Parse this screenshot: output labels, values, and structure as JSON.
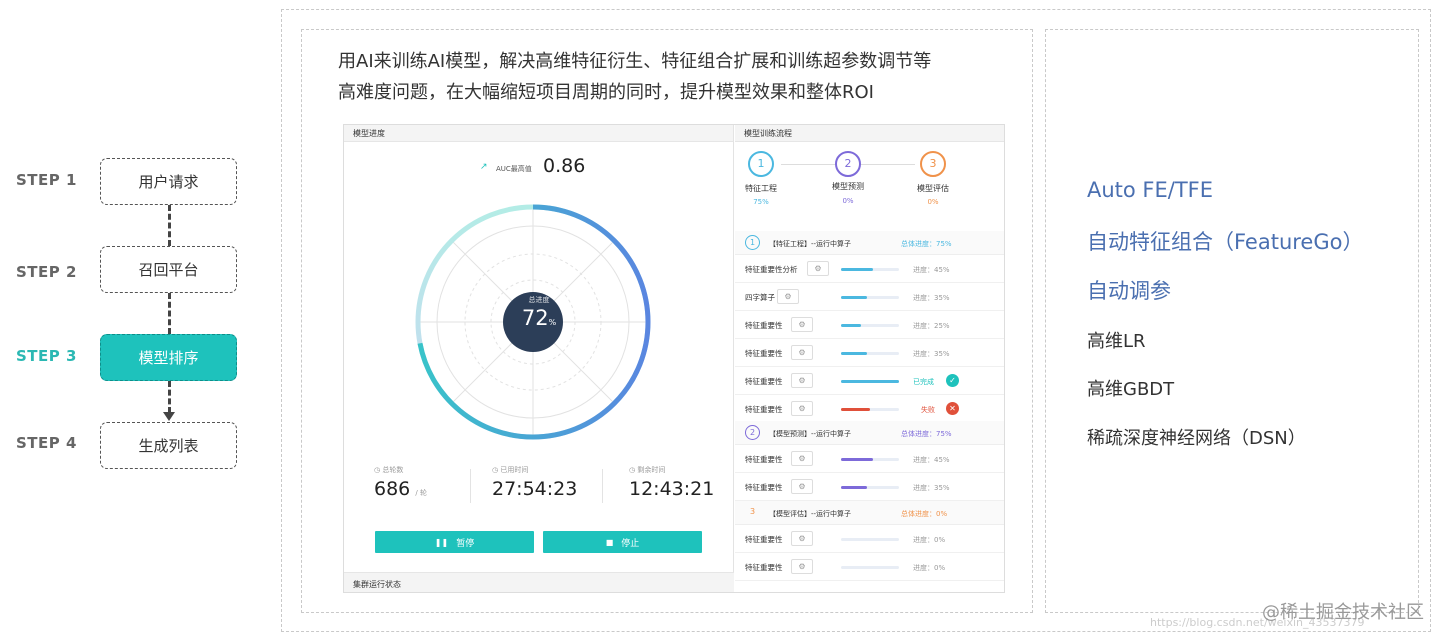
{
  "steps": [
    {
      "label": "STEP 1",
      "box": "用户请求"
    },
    {
      "label": "STEP 2",
      "box": "召回平台"
    },
    {
      "label": "STEP 3",
      "box": "模型排序"
    },
    {
      "label": "STEP 4",
      "box": "生成列表"
    }
  ],
  "intro": {
    "line1": "用AI来训练AI模型，解决高维特征衍生、特征组合扩展和训练超参数调节等",
    "line2": "高难度问题，在大幅缩短项目周期的同时，提升模型效果和整体ROI"
  },
  "left_panel": {
    "title": "模型进度",
    "auc_label": "AUC最高值",
    "auc_value": "0.86",
    "total_label": "总进度",
    "total_value": "72",
    "total_unit": "%",
    "total_fraction": 0.72,
    "stats": [
      {
        "label": "总轮数",
        "value": "686",
        "unit": "/ 轮"
      },
      {
        "label": "已用时间",
        "value": "27:54:23",
        "unit": ""
      },
      {
        "label": "剩余时间",
        "value": "12:43:21",
        "unit": ""
      }
    ],
    "pause_button": "暂停",
    "stop_button": "停止",
    "cluster_title": "集群运行状态"
  },
  "right_panel": {
    "title": "模型训练流程",
    "stages": [
      {
        "num": "1",
        "name": "特征工程",
        "pct": "75%",
        "color": "#4bb8e0"
      },
      {
        "num": "2",
        "name": "模型预测",
        "pct": "0%",
        "color": "#7d6ad9"
      },
      {
        "num": "3",
        "name": "模型评估",
        "pct": "0%",
        "color": "#f0924a"
      }
    ],
    "sections": [
      {
        "num": "1",
        "title": "【特征工程】--运行中算子",
        "progress": "总体进度：75%",
        "color": "#4bb8e0",
        "rows": [
          {
            "name": "特征重要性分析",
            "status": "进度：45%",
            "fill": 0.55,
            "color": "#4bb8e0"
          },
          {
            "name": "四字算子",
            "status": "进度：35%",
            "fill": 0.45,
            "color": "#4bb8e0"
          },
          {
            "name": "特征重要性",
            "status": "进度：25%",
            "fill": 0.35,
            "color": "#4bb8e0"
          },
          {
            "name": "特征重要性",
            "status": "进度：35%",
            "fill": 0.45,
            "color": "#4bb8e0"
          },
          {
            "name": "特征重要性",
            "status": "已完成",
            "fill": 1.0,
            "color": "#4bb8e0"
          },
          {
            "name": "特征重要性",
            "status": "失败",
            "fill": 0.5,
            "color": "#e0503a"
          }
        ]
      },
      {
        "num": "2",
        "title": "【模型预测】--运行中算子",
        "progress": "总体进度：75%",
        "color": "#7d6ad9",
        "rows": [
          {
            "name": "特征重要性",
            "status": "进度：45%",
            "fill": 0.55,
            "color": "#7d6ad9"
          },
          {
            "name": "特征重要性",
            "status": "进度：35%",
            "fill": 0.45,
            "color": "#7d6ad9"
          }
        ]
      },
      {
        "num": "3",
        "title": "【模型评估】--运行中算子",
        "progress": "总体进度：0%",
        "color": "#f0924a",
        "rows": [
          {
            "name": "特征重要性",
            "status": "进度：0%",
            "fill": 0.0,
            "color": "#f0924a"
          },
          {
            "name": "特征重要性",
            "status": "进度：0%",
            "fill": 0.0,
            "color": "#f0924a"
          }
        ]
      }
    ]
  },
  "features": [
    "Auto FE/TFE",
    "自动特征组合（FeatureGo）",
    "自动调参",
    "高维LR",
    "高维GBDT",
    "稀疏深度神经网络（DSN）"
  ],
  "watermark": "@稀土掘金技术社区",
  "watermark_url": "https://blog.csdn.net/weixin_43537379"
}
